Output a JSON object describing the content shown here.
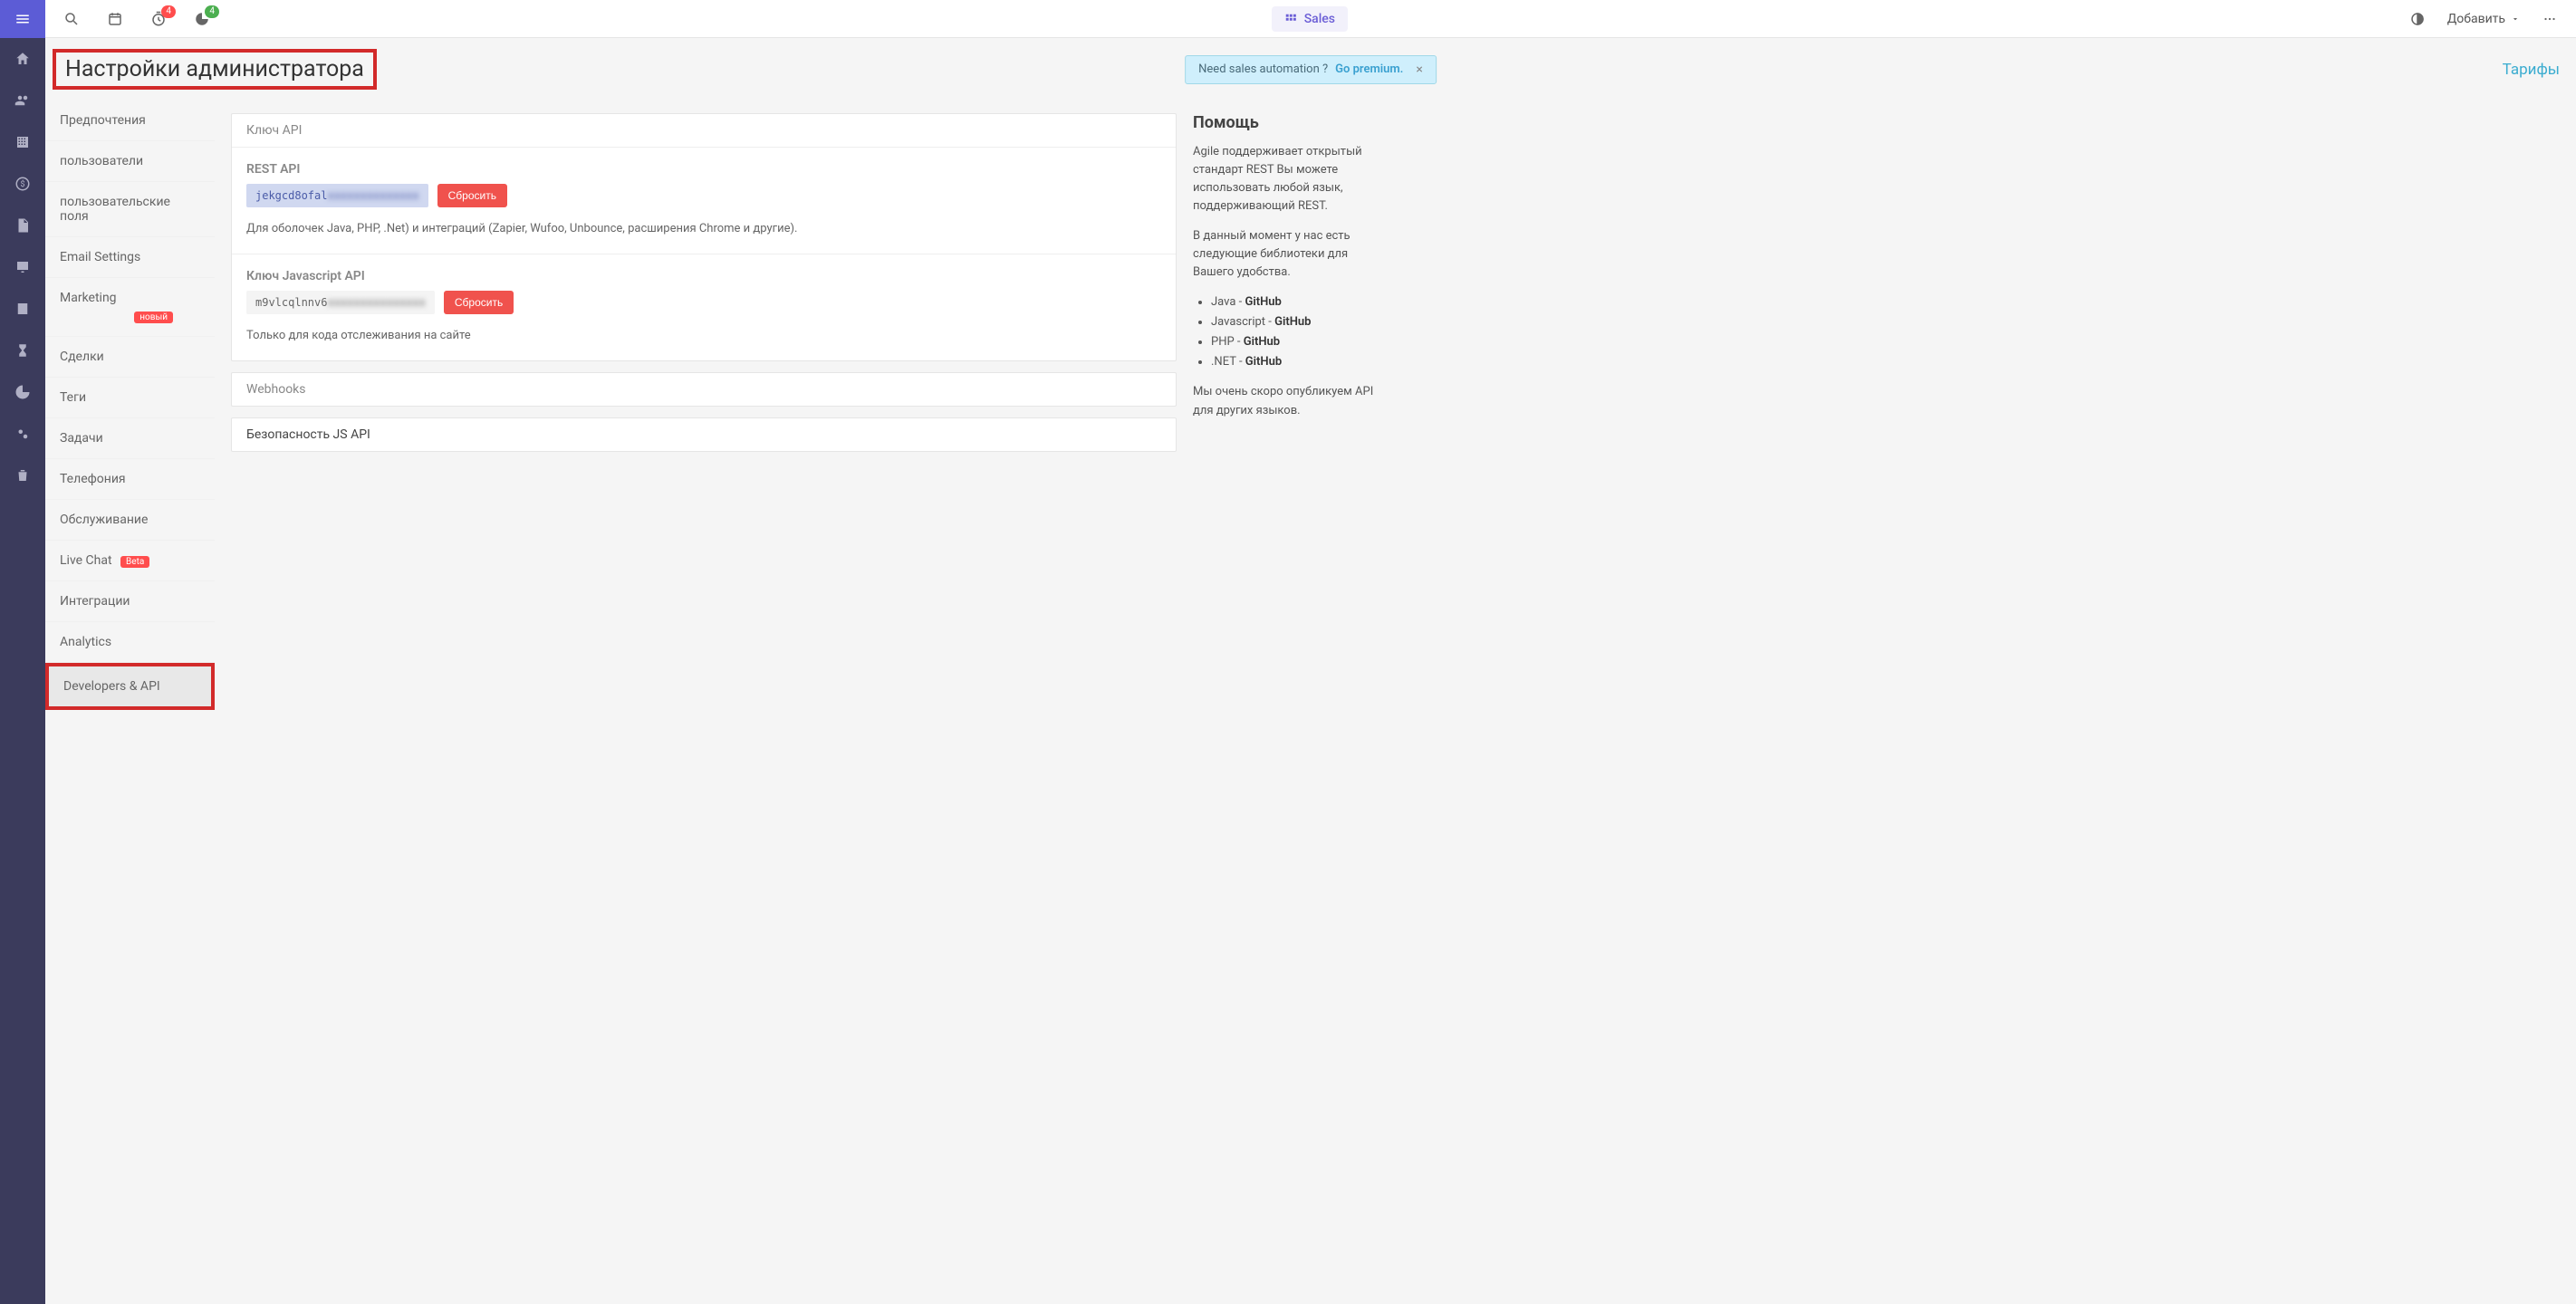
{
  "topbar": {
    "badge_timer": "4",
    "badge_pie": "4",
    "sales_label": "Sales",
    "add_label": "Добавить"
  },
  "pagehead": {
    "title": "Настройки администратора",
    "alert_text": "Need sales automation ? ",
    "alert_link": "Go premium.",
    "tarify": "Тарифы"
  },
  "settings_nav": [
    {
      "label": "Предпочтения"
    },
    {
      "label": "пользователи"
    },
    {
      "label": "пользовательские поля"
    },
    {
      "label": "Email Settings"
    },
    {
      "label": "Marketing",
      "badge": "новый"
    },
    {
      "label": "Сделки"
    },
    {
      "label": "Теги"
    },
    {
      "label": "Задачи"
    },
    {
      "label": "Телефония"
    },
    {
      "label": "Обслуживание"
    },
    {
      "label": "Live Chat",
      "badge": "Beta"
    },
    {
      "label": "Интеграции"
    },
    {
      "label": "Analytics"
    },
    {
      "label": "Developers & API",
      "active": true
    }
  ],
  "main": {
    "api_key_header": "Ключ API",
    "rest_api_label": "REST API",
    "rest_api_key_visible": "jekgcd8ofal",
    "rest_api_key_hidden": "xxxxxxxxxxxxxx",
    "reset_btn": "Сбросить",
    "rest_desc": "Для оболочек Java, PHP, .Net) и интеграций (Zapier, Wufoo, Unbounce, расширения Chrome и другие).",
    "js_api_label": "Ключ Javascript API",
    "js_api_key_visible": "m9vlcqlnnv6",
    "js_api_key_hidden": "xxxxxxxxxxxxxxx",
    "js_desc": "Только для кода отслеживания на сайте",
    "webhooks_label": "Webhooks",
    "security_label": "Безопасность JS API"
  },
  "help": {
    "title": "Помощь",
    "p1": "Agile поддерживает открытый стандарт REST Вы можете использовать любой язык, поддерживающий REST.",
    "p2": "В данный момент у нас есть следующие библиотеки для Вашего удобства.",
    "libs": [
      {
        "lang": "Java",
        "link": "GitHub"
      },
      {
        "lang": "Javascript",
        "link": "GitHub"
      },
      {
        "lang": "PHP",
        "link": "GitHub"
      },
      {
        "lang": ".NET",
        "link": "GitHub"
      }
    ],
    "p3": "Мы очень скоро опубликуем API для других языков."
  }
}
